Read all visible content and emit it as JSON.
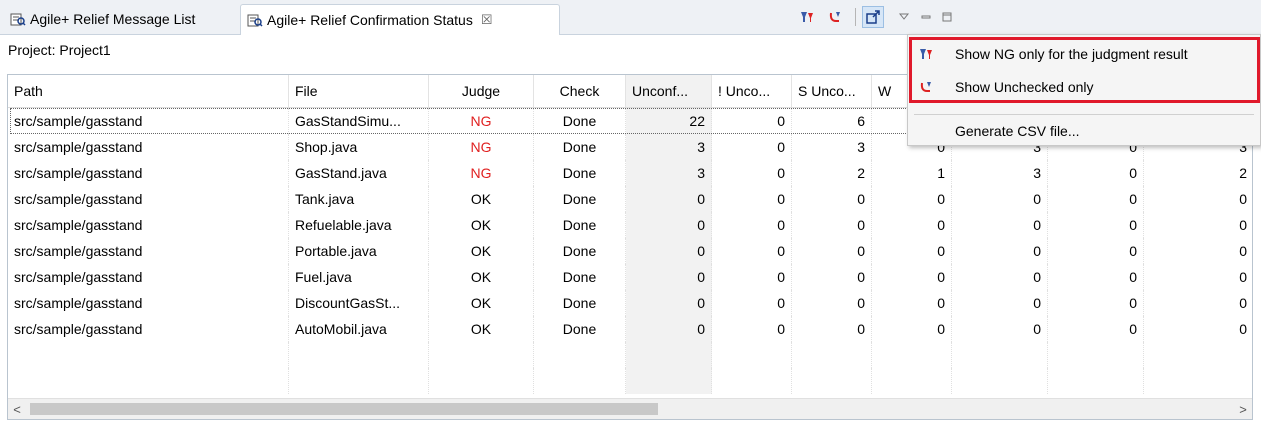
{
  "tabs": [
    {
      "label": "Agile+ Relief Message List",
      "active": false
    },
    {
      "label": "Agile+ Relief Confirmation Status",
      "active": true,
      "close": "☒"
    }
  ],
  "toolbar": {
    "icons": [
      "ng-filter-icon",
      "unchecked-filter-icon",
      "export-icon",
      "view-menu-icon",
      "minimize-icon",
      "maximize-icon"
    ]
  },
  "project": {
    "label": "Project:",
    "value": "Project1"
  },
  "table": {
    "columns": [
      "Path",
      "File",
      "Judge",
      "Check",
      "Unconf...",
      "! Unco...",
      "S Unco...",
      "W",
      "",
      "",
      ""
    ],
    "rows": [
      {
        "path": "src/sample/gasstand",
        "file": "GasStandSimu...",
        "judge": "NG",
        "check": "Done",
        "v": [
          "22",
          "0",
          "6",
          "",
          "",
          "",
          ""
        ]
      },
      {
        "path": "src/sample/gasstand",
        "file": "Shop.java",
        "judge": "NG",
        "check": "Done",
        "v": [
          "3",
          "0",
          "3",
          "0",
          "3",
          "0",
          "3"
        ]
      },
      {
        "path": "src/sample/gasstand",
        "file": "GasStand.java",
        "judge": "NG",
        "check": "Done",
        "v": [
          "3",
          "0",
          "2",
          "1",
          "3",
          "0",
          "2"
        ]
      },
      {
        "path": "src/sample/gasstand",
        "file": "Tank.java",
        "judge": "OK",
        "check": "Done",
        "v": [
          "0",
          "0",
          "0",
          "0",
          "0",
          "0",
          "0"
        ]
      },
      {
        "path": "src/sample/gasstand",
        "file": "Refuelable.java",
        "judge": "OK",
        "check": "Done",
        "v": [
          "0",
          "0",
          "0",
          "0",
          "0",
          "0",
          "0"
        ]
      },
      {
        "path": "src/sample/gasstand",
        "file": "Portable.java",
        "judge": "OK",
        "check": "Done",
        "v": [
          "0",
          "0",
          "0",
          "0",
          "0",
          "0",
          "0"
        ]
      },
      {
        "path": "src/sample/gasstand",
        "file": "Fuel.java",
        "judge": "OK",
        "check": "Done",
        "v": [
          "0",
          "0",
          "0",
          "0",
          "0",
          "0",
          "0"
        ]
      },
      {
        "path": "src/sample/gasstand",
        "file": "DiscountGasSt...",
        "judge": "OK",
        "check": "Done",
        "v": [
          "0",
          "0",
          "0",
          "0",
          "0",
          "0",
          "0"
        ]
      },
      {
        "path": "src/sample/gasstand",
        "file": "AutoMobil.java",
        "judge": "OK",
        "check": "Done",
        "v": [
          "0",
          "0",
          "0",
          "0",
          "0",
          "0",
          "0"
        ]
      }
    ]
  },
  "scroll": {
    "left_arrow": "<",
    "right_arrow": ">"
  },
  "menu": {
    "items": [
      {
        "label": "Show NG only for the judgment result",
        "icon": "ng-filter-icon"
      },
      {
        "label": "Show Unchecked only",
        "icon": "unchecked-filter-icon"
      },
      {
        "label": "Generate CSV file...",
        "icon": ""
      }
    ]
  },
  "colors": {
    "ng": "#e02020",
    "highlight": "#e0192b",
    "accent": "#9cbfe3"
  }
}
